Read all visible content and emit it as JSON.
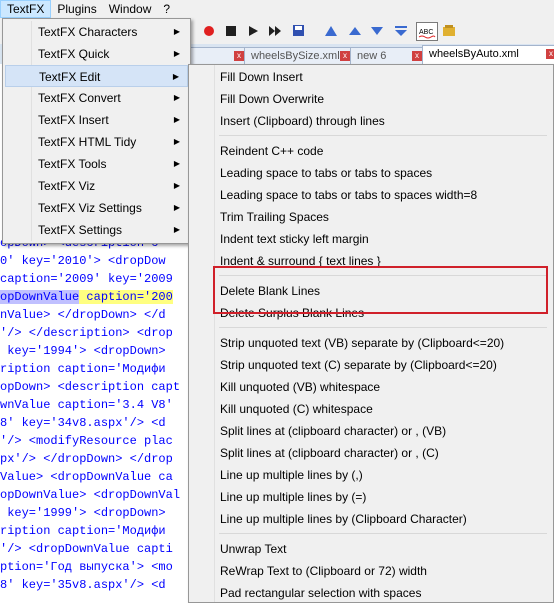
{
  "menubar": [
    "TextFX",
    "Plugins",
    "Window",
    "?"
  ],
  "tabs": [
    "",
    "wheelsBySize.xml",
    "new 6",
    "wheelsByAuto.xml"
  ],
  "toolbar_icons": [
    "record-icon",
    "stop-icon",
    "play-icon",
    "play-multi-icon",
    "save-macro-icon",
    "wrap-icon",
    "fold-up-icon",
    "fold-down-icon",
    "fold-all-icon",
    "spellcheck-icon",
    "macro-icon"
  ],
  "code_lines": [
    {
      "a": "opDown> <description c",
      "b": "",
      "c": ""
    },
    {
      "a": "0' key='2010'> <dropDow",
      "b": "",
      "c": ""
    },
    {
      "a": "caption='2009' key='2009",
      "b": "",
      "c": ""
    },
    {
      "a": "opDownValue",
      "b": " caption='200",
      "c": ""
    },
    {
      "a": "nValue> </dropDown> </d",
      "b": "",
      "c": ""
    },
    {
      "a": "'/> </description> <drop",
      "b": "",
      "c": ""
    },
    {
      "a": " key='1994'> <dropDown>",
      "b": "",
      "c": ""
    },
    {
      "a": "ription caption='Модифи",
      "b": "",
      "c": ""
    },
    {
      "a": "opDown> <description capt",
      "b": "",
      "c": ""
    },
    {
      "a": "wnValue caption='3.4 V8'",
      "b": "",
      "c": ""
    },
    {
      "a": "8' key='34v8.aspx'/> <d",
      "b": "",
      "c": ""
    },
    {
      "a": "'/> <modifyResource plac",
      "b": "",
      "c": ""
    },
    {
      "a": "px'/> </dropDown> </drop",
      "b": "",
      "c": ""
    },
    {
      "a": "Value> <dropDownValue ca",
      "b": "",
      "c": ""
    },
    {
      "a": "opDownValue> <dropDownVal",
      "b": "",
      "c": ""
    },
    {
      "a": " key='1999'> <dropDown>",
      "b": "",
      "c": ""
    },
    {
      "a": "ription caption='Модифи",
      "b": "",
      "c": ""
    },
    {
      "a": "'/> <dropDownValue capti",
      "b": "",
      "c": ""
    },
    {
      "a": "ption='Год выпуска'> <mo",
      "b": "",
      "c": ""
    },
    {
      "a": "8' key='35v8.aspx'/> <d",
      "b": "",
      "c": ""
    }
  ],
  "textfx_menu": [
    "TextFX Characters",
    "TextFX Quick",
    "TextFX Edit",
    "TextFX Convert",
    "TextFX Insert",
    "TextFX HTML Tidy",
    "TextFX Tools",
    "TextFX Viz",
    "TextFX Viz Settings",
    "TextFX Settings"
  ],
  "edit_menu": [
    "Fill Down Insert",
    "Fill Down Overwrite",
    "Insert (Clipboard) through lines",
    "Reindent C++ code",
    "Leading space to tabs or tabs to spaces",
    "Leading space to tabs or tabs to spaces width=8",
    "Trim Trailing Spaces",
    "Indent text sticky left margin",
    "Indent & surround { text lines }",
    "Delete Blank Lines",
    "Delete Surplus Blank Lines",
    "Strip unquoted text (VB) separate by (Clipboard<=20)",
    "Strip unquoted text (C) separate by (Clipboard<=20)",
    "Kill unquoted (VB) whitespace",
    "Kill unquoted (C) whitespace",
    "Split lines at (clipboard character) or , (VB)",
    "Split lines at (clipboard character) or , (C)",
    "Line up multiple lines by (,)",
    "Line up multiple lines by (=)",
    "Line up multiple lines by (Clipboard Character)",
    "Unwrap Text",
    "ReWrap Text to (Clipboard or 72) width",
    "Pad rectangular selection with spaces"
  ],
  "colors": {
    "highlight_box": "#d0202a",
    "menu_bg": "#f0f0f0",
    "hover": "#d5e4f7"
  }
}
